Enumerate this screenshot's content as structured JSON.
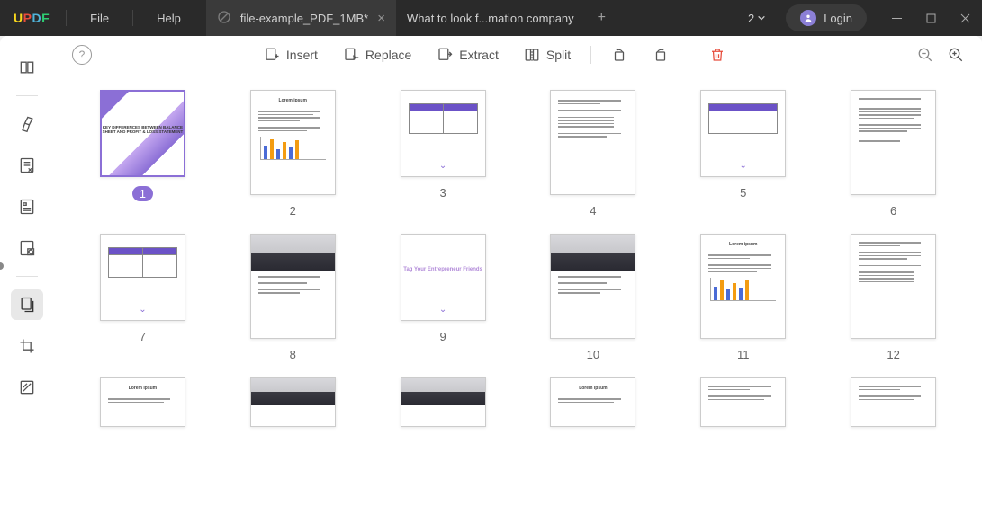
{
  "app": {
    "name": "UPDF",
    "menu": {
      "file": "File",
      "help": "Help"
    }
  },
  "tabs": {
    "active": {
      "label": "file-example_PDF_1MB*"
    },
    "inactive": {
      "label": "What to look f...mation company"
    }
  },
  "top": {
    "count": "2",
    "login": "Login"
  },
  "toolbar": {
    "insert": "Insert",
    "replace": "Replace",
    "extract": "Extract",
    "split": "Split"
  },
  "pages": {
    "p1": "1",
    "p2": "2",
    "p3": "3",
    "p4": "4",
    "p5": "5",
    "p6": "6",
    "p7": "7",
    "p8": "8",
    "p9": "9",
    "p10": "10",
    "p11": "11",
    "p12": "12"
  },
  "thumbs": {
    "coverTitle": "KEY DIFFERENCES BETWEEN BALANCE SHEET AND PROFIT & LOSS STATEMENT",
    "lorem": "Lorem ipsum",
    "tag": "Tag Your Entrepreneur Friends"
  }
}
